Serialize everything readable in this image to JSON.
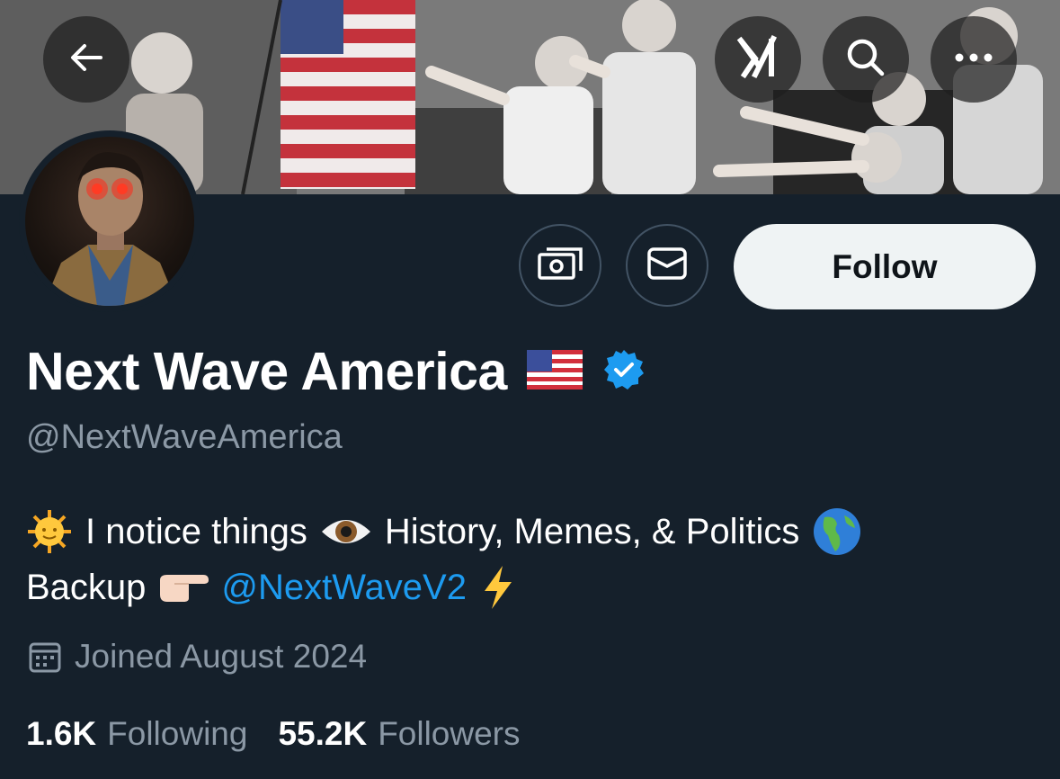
{
  "header": {
    "back_icon": "arrow-left-icon",
    "grok_icon": "grok-icon",
    "search_icon": "search-icon",
    "more_icon": "more-horizontal-icon"
  },
  "profile": {
    "display_name": "Next Wave America",
    "flag_icon": "us-flag-emoji",
    "verified_icon": "verified-badge-icon",
    "verified_color": "#1d9bf0",
    "handle": "@NextWaveAmerica",
    "bio": {
      "line1": {
        "sun_icon": "sun-with-face-emoji",
        "text1": "I notice things",
        "eye_icon": "eye-emoji",
        "text2": "History, Memes, & Politics",
        "globe_icon": "globe-americas-emoji"
      },
      "line2": {
        "text1": "Backup",
        "pointing_icon": "pointing-right-emoji",
        "link": "@NextWaveV2",
        "bolt_icon": "lightning-emoji"
      }
    },
    "joined_icon": "calendar-icon",
    "joined": "Joined August 2024",
    "following_count": "1.6K",
    "following_label": "Following",
    "followers_count": "55.2K",
    "followers_label": "Followers"
  },
  "actions": {
    "subscribe_icon": "money-icon",
    "message_icon": "envelope-icon",
    "follow_label": "Follow"
  },
  "colors": {
    "background": "#15202b",
    "secondary_text": "#8b98a5",
    "accent": "#1d9bf0",
    "follow_bg": "#eff3f4"
  }
}
